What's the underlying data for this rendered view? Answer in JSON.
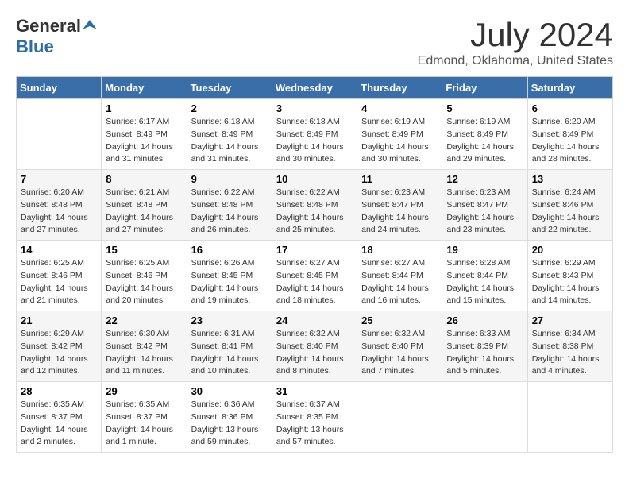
{
  "logo": {
    "general": "General",
    "blue": "Blue"
  },
  "title": "July 2024",
  "location": "Edmond, Oklahoma, United States",
  "days_of_week": [
    "Sunday",
    "Monday",
    "Tuesday",
    "Wednesday",
    "Thursday",
    "Friday",
    "Saturday"
  ],
  "weeks": [
    [
      {
        "day": "",
        "info": ""
      },
      {
        "day": "1",
        "info": "Sunrise: 6:17 AM\nSunset: 8:49 PM\nDaylight: 14 hours\nand 31 minutes."
      },
      {
        "day": "2",
        "info": "Sunrise: 6:18 AM\nSunset: 8:49 PM\nDaylight: 14 hours\nand 31 minutes."
      },
      {
        "day": "3",
        "info": "Sunrise: 6:18 AM\nSunset: 8:49 PM\nDaylight: 14 hours\nand 30 minutes."
      },
      {
        "day": "4",
        "info": "Sunrise: 6:19 AM\nSunset: 8:49 PM\nDaylight: 14 hours\nand 30 minutes."
      },
      {
        "day": "5",
        "info": "Sunrise: 6:19 AM\nSunset: 8:49 PM\nDaylight: 14 hours\nand 29 minutes."
      },
      {
        "day": "6",
        "info": "Sunrise: 6:20 AM\nSunset: 8:49 PM\nDaylight: 14 hours\nand 28 minutes."
      }
    ],
    [
      {
        "day": "7",
        "info": "Sunrise: 6:20 AM\nSunset: 8:48 PM\nDaylight: 14 hours\nand 27 minutes."
      },
      {
        "day": "8",
        "info": "Sunrise: 6:21 AM\nSunset: 8:48 PM\nDaylight: 14 hours\nand 27 minutes."
      },
      {
        "day": "9",
        "info": "Sunrise: 6:22 AM\nSunset: 8:48 PM\nDaylight: 14 hours\nand 26 minutes."
      },
      {
        "day": "10",
        "info": "Sunrise: 6:22 AM\nSunset: 8:48 PM\nDaylight: 14 hours\nand 25 minutes."
      },
      {
        "day": "11",
        "info": "Sunrise: 6:23 AM\nSunset: 8:47 PM\nDaylight: 14 hours\nand 24 minutes."
      },
      {
        "day": "12",
        "info": "Sunrise: 6:23 AM\nSunset: 8:47 PM\nDaylight: 14 hours\nand 23 minutes."
      },
      {
        "day": "13",
        "info": "Sunrise: 6:24 AM\nSunset: 8:46 PM\nDaylight: 14 hours\nand 22 minutes."
      }
    ],
    [
      {
        "day": "14",
        "info": "Sunrise: 6:25 AM\nSunset: 8:46 PM\nDaylight: 14 hours\nand 21 minutes."
      },
      {
        "day": "15",
        "info": "Sunrise: 6:25 AM\nSunset: 8:46 PM\nDaylight: 14 hours\nand 20 minutes."
      },
      {
        "day": "16",
        "info": "Sunrise: 6:26 AM\nSunset: 8:45 PM\nDaylight: 14 hours\nand 19 minutes."
      },
      {
        "day": "17",
        "info": "Sunrise: 6:27 AM\nSunset: 8:45 PM\nDaylight: 14 hours\nand 18 minutes."
      },
      {
        "day": "18",
        "info": "Sunrise: 6:27 AM\nSunset: 8:44 PM\nDaylight: 14 hours\nand 16 minutes."
      },
      {
        "day": "19",
        "info": "Sunrise: 6:28 AM\nSunset: 8:44 PM\nDaylight: 14 hours\nand 15 minutes."
      },
      {
        "day": "20",
        "info": "Sunrise: 6:29 AM\nSunset: 8:43 PM\nDaylight: 14 hours\nand 14 minutes."
      }
    ],
    [
      {
        "day": "21",
        "info": "Sunrise: 6:29 AM\nSunset: 8:42 PM\nDaylight: 14 hours\nand 12 minutes."
      },
      {
        "day": "22",
        "info": "Sunrise: 6:30 AM\nSunset: 8:42 PM\nDaylight: 14 hours\nand 11 minutes."
      },
      {
        "day": "23",
        "info": "Sunrise: 6:31 AM\nSunset: 8:41 PM\nDaylight: 14 hours\nand 10 minutes."
      },
      {
        "day": "24",
        "info": "Sunrise: 6:32 AM\nSunset: 8:40 PM\nDaylight: 14 hours\nand 8 minutes."
      },
      {
        "day": "25",
        "info": "Sunrise: 6:32 AM\nSunset: 8:40 PM\nDaylight: 14 hours\nand 7 minutes."
      },
      {
        "day": "26",
        "info": "Sunrise: 6:33 AM\nSunset: 8:39 PM\nDaylight: 14 hours\nand 5 minutes."
      },
      {
        "day": "27",
        "info": "Sunrise: 6:34 AM\nSunset: 8:38 PM\nDaylight: 14 hours\nand 4 minutes."
      }
    ],
    [
      {
        "day": "28",
        "info": "Sunrise: 6:35 AM\nSunset: 8:37 PM\nDaylight: 14 hours\nand 2 minutes."
      },
      {
        "day": "29",
        "info": "Sunrise: 6:35 AM\nSunset: 8:37 PM\nDaylight: 14 hours\nand 1 minute."
      },
      {
        "day": "30",
        "info": "Sunrise: 6:36 AM\nSunset: 8:36 PM\nDaylight: 13 hours\nand 59 minutes."
      },
      {
        "day": "31",
        "info": "Sunrise: 6:37 AM\nSunset: 8:35 PM\nDaylight: 13 hours\nand 57 minutes."
      },
      {
        "day": "",
        "info": ""
      },
      {
        "day": "",
        "info": ""
      },
      {
        "day": "",
        "info": ""
      }
    ]
  ]
}
